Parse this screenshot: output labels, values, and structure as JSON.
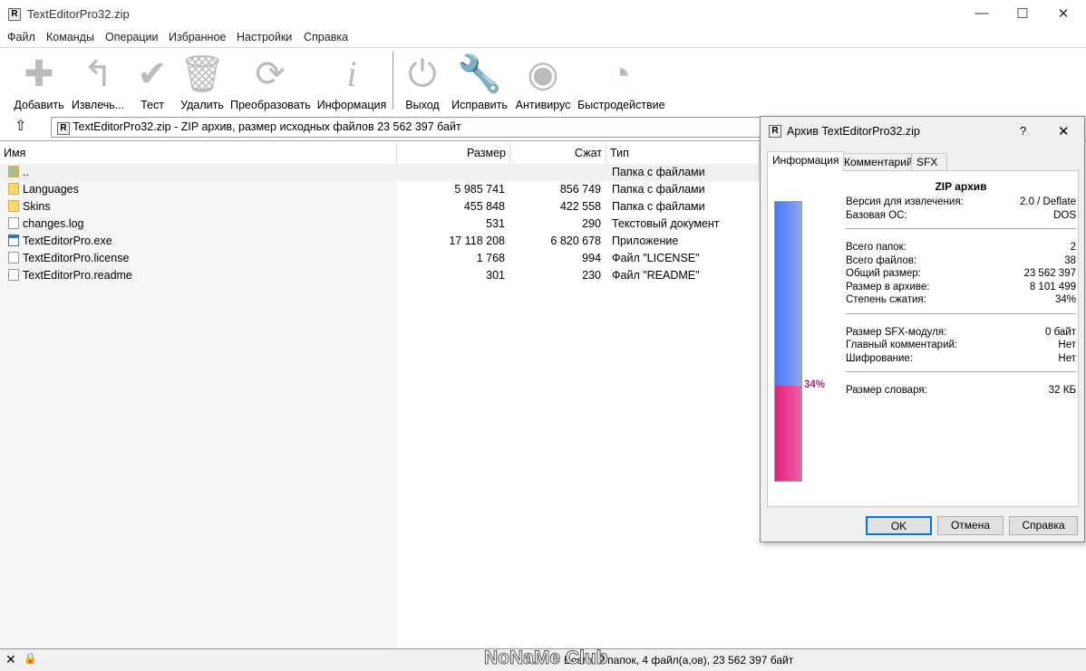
{
  "window": {
    "title": "TextEditorPro32.zip",
    "app_icon": "R",
    "controls": [
      "—",
      "☐",
      "✕"
    ]
  },
  "menu": [
    "Файл",
    "Команды",
    "Операции",
    "Избранное",
    "Настройки",
    "Справка"
  ],
  "toolbar": [
    {
      "label": "Добавить",
      "icon": "plus-icon"
    },
    {
      "label": "Извлечь...",
      "icon": "extract-arrow-icon"
    },
    {
      "label": "Тест",
      "icon": "checkmark-icon"
    },
    {
      "label": "Удалить",
      "icon": "trash-icon"
    },
    {
      "label": "Преобразовать",
      "icon": "convert-icon"
    },
    {
      "label": "Информация",
      "icon": "info-icon"
    },
    {
      "label": "Выход",
      "icon": "power-icon"
    },
    {
      "label": "Исправить",
      "icon": "wrench-icon"
    },
    {
      "label": "Антивирус",
      "icon": "antivirus-icon"
    },
    {
      "label": "Быстродействие",
      "icon": "gauge-icon"
    }
  ],
  "address": "TextEditorPro32.zip - ZIP архив, размер исходных файлов 23 562 397 байт",
  "columns": [
    "Имя",
    "Размер",
    "Сжат",
    "Тип"
  ],
  "files": [
    {
      "name": "..",
      "size": "",
      "packed": "",
      "type": "Папка с файлами",
      "kind": "up"
    },
    {
      "name": "Languages",
      "size": "5 985 741",
      "packed": "856 749",
      "type": "Папка с файлами",
      "kind": "folder"
    },
    {
      "name": "Skins",
      "size": "455 848",
      "packed": "422 558",
      "type": "Папка с файлами",
      "kind": "folder"
    },
    {
      "name": "changes.log",
      "size": "531",
      "packed": "290",
      "type": "Текстовый документ",
      "kind": "file"
    },
    {
      "name": "TextEditorPro.exe",
      "size": "17 118 208",
      "packed": "6 820 678",
      "type": "Приложение",
      "kind": "exe"
    },
    {
      "name": "TextEditorPro.license",
      "size": "1 768",
      "packed": "994",
      "type": "Файл \"LICENSE\"",
      "kind": "file"
    },
    {
      "name": "TextEditorPro.readme",
      "size": "301",
      "packed": "230",
      "type": "Файл \"README\"",
      "kind": "file"
    }
  ],
  "status": {
    "text": "Всего: 2 папок, 4 файл(а,ов), 23 562 397 байт",
    "watermark": "NoNaMe Club"
  },
  "dialog": {
    "title": "Архив TextEditorPro32.zip",
    "help": "?",
    "close": "✕",
    "tabs": [
      "Информация",
      "Комментарий",
      "SFX"
    ],
    "heading": "ZIP архив",
    "ratio_percent": 34,
    "ratio_label": "34%",
    "colors": {
      "original": "#5b85f0",
      "packed": "#e8388f"
    },
    "groups": [
      [
        {
          "k": "Версия для извлечения:",
          "v": "2.0 / Deflate"
        },
        {
          "k": "Базовая ОС:",
          "v": "DOS"
        }
      ],
      [
        {
          "k": "Всего папок:",
          "v": "2"
        },
        {
          "k": "Всего файлов:",
          "v": "38"
        },
        {
          "k": "Общий размер:",
          "v": "23 562 397"
        },
        {
          "k": "Размер в архиве:",
          "v": "8 101 499"
        },
        {
          "k": "Степень сжатия:",
          "v": "34%"
        }
      ],
      [
        {
          "k": "Размер SFX-модуля:",
          "v": "0 байт"
        },
        {
          "k": "Главный комментарий:",
          "v": "Нет"
        },
        {
          "k": "Шифрование:",
          "v": "Нет"
        }
      ],
      [
        {
          "k": "Размер словаря:",
          "v": "32 КБ"
        }
      ]
    ],
    "buttons": [
      "OK",
      "Отмена",
      "Справка"
    ]
  }
}
